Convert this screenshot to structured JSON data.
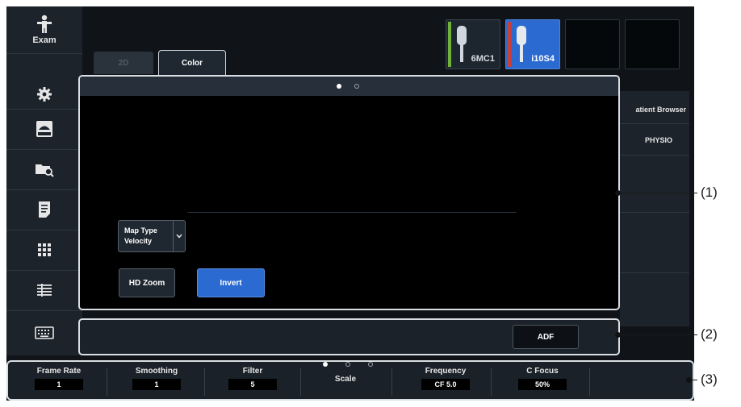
{
  "sidebar": {
    "items": [
      {
        "icon": "exam-icon",
        "label": "Exam"
      },
      {
        "icon": "gear-icon"
      },
      {
        "icon": "preset-icon",
        "label": "Preset"
      },
      {
        "icon": "folder-search-icon"
      },
      {
        "icon": "report-icon"
      },
      {
        "icon": "grid-icon"
      },
      {
        "icon": "list-icon"
      },
      {
        "icon": "keyboard-icon"
      }
    ]
  },
  "tabs": [
    {
      "label": "2D",
      "active": false
    },
    {
      "label": "Color",
      "active": true
    }
  ],
  "probes": [
    {
      "label": "6MC1",
      "accent": "#6fb33a",
      "active": false
    },
    {
      "label": "i10S4",
      "accent": "#c7403a",
      "active": true
    },
    {
      "label": "",
      "active": false
    },
    {
      "label": "",
      "active": false
    }
  ],
  "right_menu": {
    "patient_browser": "atient Browser",
    "physio": "PHYSIO"
  },
  "color_panel": {
    "page_dots": {
      "total": 2,
      "active": 1
    },
    "map_type": {
      "label": "Map Type",
      "value": "Velocity"
    },
    "hd_zoom_label": "HD Zoom",
    "invert_label": "Invert"
  },
  "adf_label": "ADF",
  "bottom_bar": {
    "page_dots": {
      "total": 3,
      "active": 1
    },
    "params": [
      {
        "label": "Frame Rate",
        "value": "1"
      },
      {
        "label": "Smoothing",
        "value": "1"
      },
      {
        "label": "Filter",
        "value": "5"
      },
      {
        "label": "Scale",
        "value": ""
      },
      {
        "label": "Frequency",
        "value": "CF 5.0"
      },
      {
        "label": "C Focus",
        "value": "50%"
      }
    ]
  },
  "callouts": [
    "(1)",
    "(2)",
    "(3)"
  ],
  "colors": {
    "accent_blue": "#2a6ad1",
    "panel_border": "#d9dee3",
    "background": "#101419"
  }
}
